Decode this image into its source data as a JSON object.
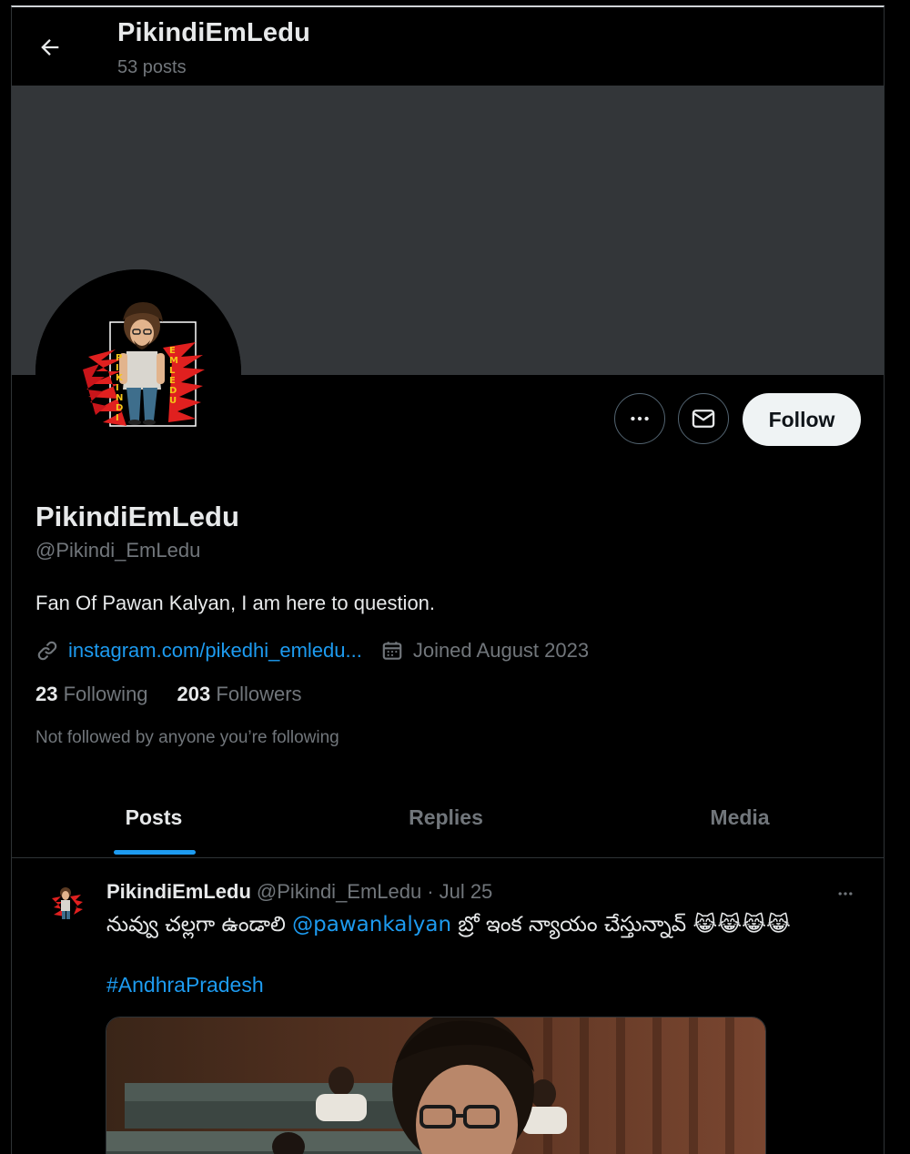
{
  "header": {
    "title": "PikindiEmLedu",
    "post_count": "53 posts"
  },
  "profile": {
    "display_name": "PikindiEmLedu",
    "handle": "@Pikindi_EmLedu",
    "bio": "Fan Of Pawan Kalyan, I am here to question.",
    "link": "instagram.com/pikedhi_emledu...",
    "joined": "Joined August 2023",
    "following_count": "23",
    "following_label": "Following",
    "followers_count": "203",
    "followers_label": "Followers",
    "not_followed": "Not followed by anyone you’re following",
    "avatar_logo_text_left": "PIKINDI",
    "avatar_logo_text_right": "EMLEDU"
  },
  "actions": {
    "follow_label": "Follow",
    "more_icon": "more-icon",
    "message_icon": "mail-icon"
  },
  "tabs": [
    {
      "label": "Posts",
      "active": true
    },
    {
      "label": "Replies",
      "active": false
    },
    {
      "label": "Media",
      "active": false
    }
  ],
  "post": {
    "author": "PikindiEmLedu",
    "handle": "@Pikindi_EmLedu",
    "separator": "·",
    "date": "Jul 25",
    "text_part1": "నువ్వు చల్లగా ఉండాలి ",
    "mention": "@pawankalyan",
    "text_part2": " బ్రో ఇంక న్యాయం చేస్తున్నావ్ ",
    "emojis": "😹😹😹😹",
    "hashtag": "#AndhraPradesh"
  },
  "colors": {
    "accent": "#1d9bf0",
    "background": "#000000",
    "banner": "#333639",
    "muted_text": "#71767b",
    "primary_text": "#e7e9ea",
    "follow_button_bg": "#eff3f4"
  }
}
